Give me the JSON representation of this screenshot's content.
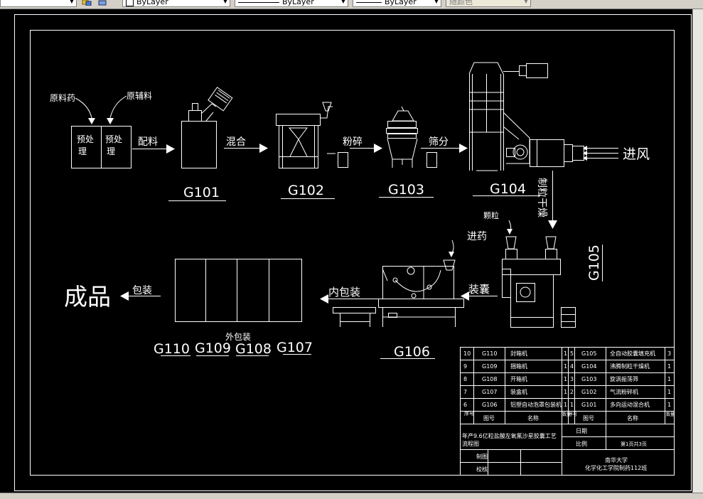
{
  "toolbar": {
    "layer_combo": "ByLayer",
    "linetype_combo": "ByLayer",
    "lineweight_combo": "ByLayer",
    "color_combo": "随颜色"
  },
  "drawing": {
    "inputs": {
      "raw_drug": "原料药",
      "raw_excipient": "原辅料"
    },
    "pretreat_left": [
      "预处",
      "理"
    ],
    "pretreat_right": [
      "预处",
      "理"
    ],
    "steps": {
      "batching": "配料",
      "mixing": "混合",
      "crushing": "粉碎",
      "sieving": "筛分",
      "granulation_drying": "制粒干燥",
      "granules": "颗粒",
      "feeding": "进药",
      "capsule_filling": "装囊",
      "inner_packing": "内包装",
      "outer_packing": "外包装",
      "packing": "包装",
      "product": "成品",
      "air_inlet": "进风"
    },
    "equipment_codes": {
      "g101": "G101",
      "g102": "G102",
      "g103": "G103",
      "g104": "G104",
      "g105": "G105",
      "g106": "G106",
      "g107": "G107",
      "g108": "G108",
      "g109": "G109",
      "g110": "G110"
    }
  },
  "title_block": {
    "left_rows": [
      {
        "no": "10",
        "code": "G110",
        "name": "封箱机",
        "qty": "1"
      },
      {
        "no": "9",
        "code": "G109",
        "name": "捆箱机",
        "qty": "1"
      },
      {
        "no": "8",
        "code": "G108",
        "name": "开箱机",
        "qty": "1"
      },
      {
        "no": "7",
        "code": "G107",
        "name": "装盒机",
        "qty": "1"
      },
      {
        "no": "6",
        "code": "G106",
        "name": "铝塑自动泡罩包装机",
        "qty": "1"
      }
    ],
    "right_rows": [
      {
        "no": "5",
        "code": "G105",
        "name": "全自动胶囊填充机",
        "qty": "3"
      },
      {
        "no": "4",
        "code": "G104",
        "name": "沸腾制粒干燥机",
        "qty": "1"
      },
      {
        "no": "3",
        "code": "G103",
        "name": "旋涡振荡筛",
        "qty": "1"
      },
      {
        "no": "2",
        "code": "G102",
        "name": "气流粉碎机",
        "qty": "1"
      },
      {
        "no": "1",
        "code": "G101",
        "name": "多向运动混合机",
        "qty": "1"
      }
    ],
    "header": {
      "no": "序号",
      "code": "图号",
      "name": "名称",
      "qty": "数量"
    },
    "project_title": [
      "年产9.6亿粒盐酸左氧氟沙星胶囊工艺",
      "流程图"
    ],
    "date_label": "日期",
    "scale_label": "比例",
    "sheet_label": "第1页共3页",
    "drawn_by": "制图",
    "checked_by": "校核",
    "school": [
      "南华大学",
      "化学化工学院制药112班"
    ]
  }
}
